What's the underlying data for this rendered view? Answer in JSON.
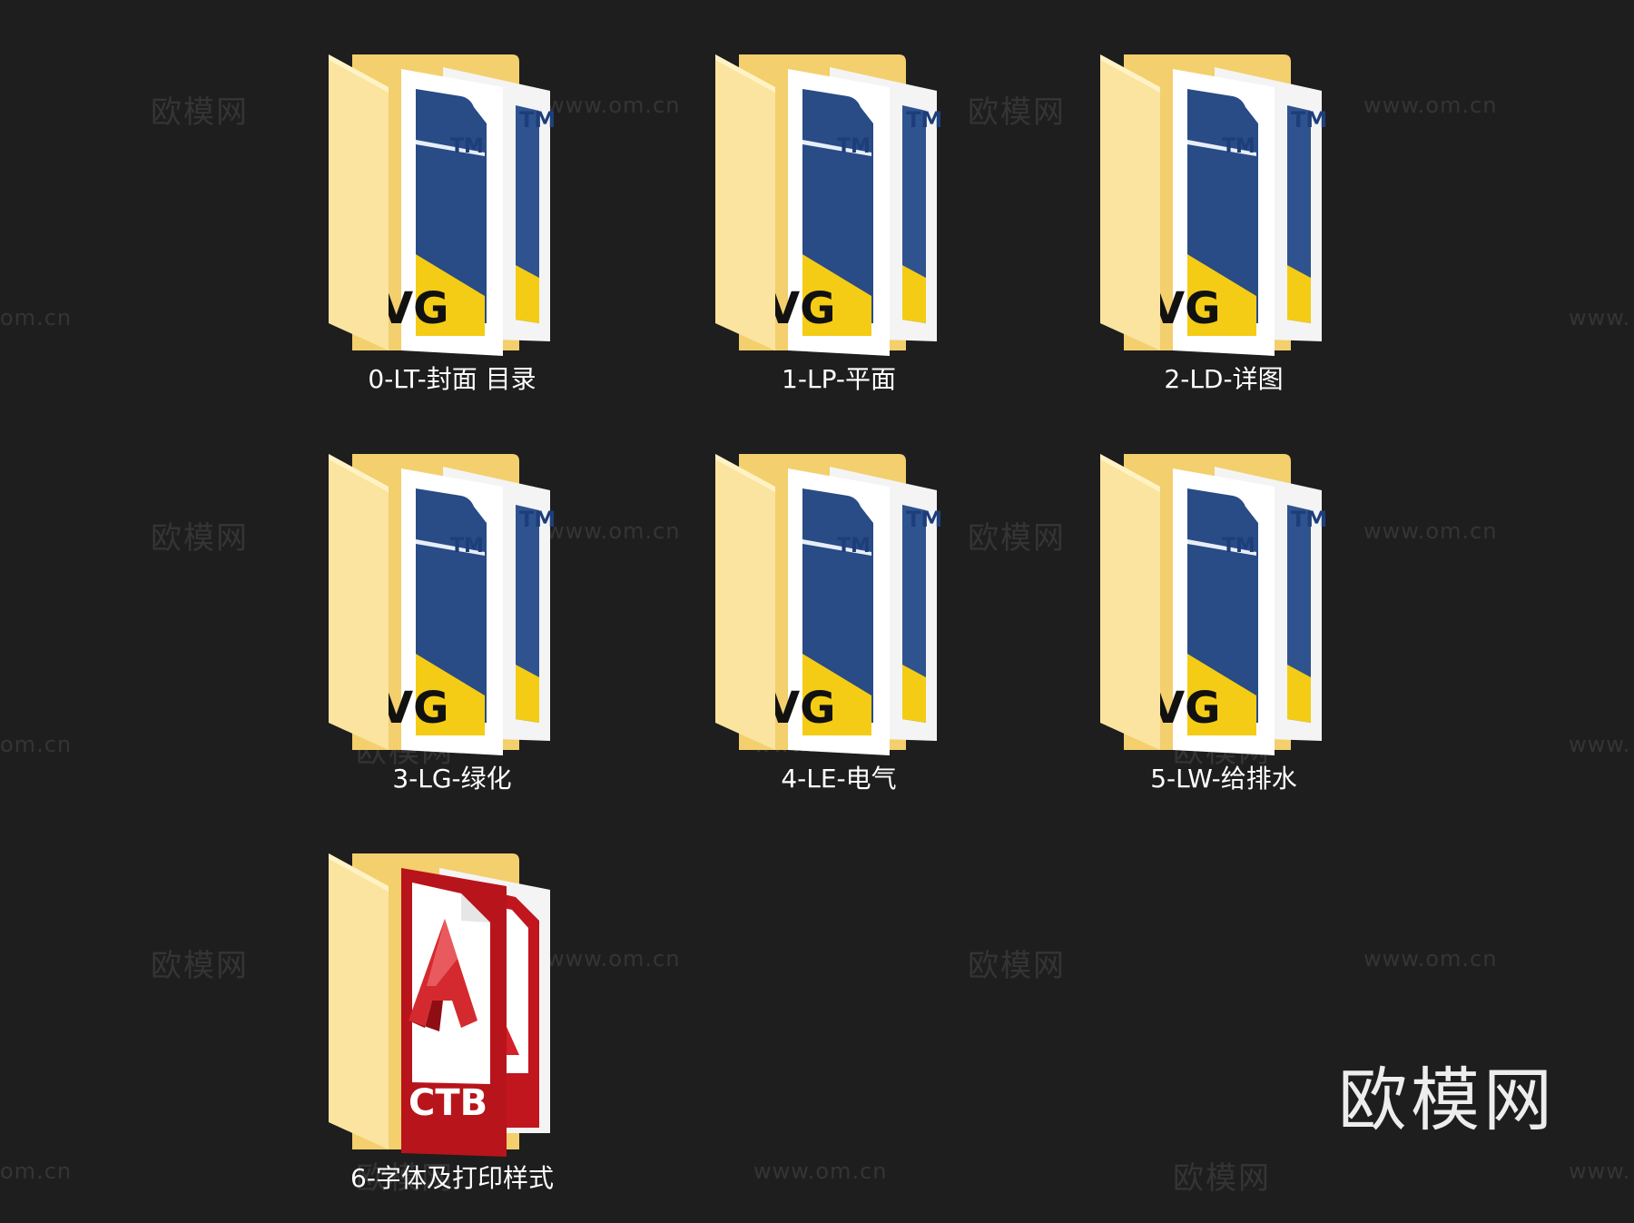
{
  "folders": [
    {
      "name": "0-LT-封面 目录",
      "type": "dwg"
    },
    {
      "name": "1-LP-平面",
      "type": "dwg"
    },
    {
      "name": "2-LD-详图",
      "type": "dwg"
    },
    {
      "name": "3-LG-绿化",
      "type": "dwg"
    },
    {
      "name": "4-LE-电气",
      "type": "dwg"
    },
    {
      "name": "5-LW-给排水",
      "type": "dwg"
    },
    {
      "name": "6-字体及打印样式",
      "type": "ctb"
    }
  ],
  "file_badges": {
    "dwg_tm": "TM",
    "dwg_text": "VG",
    "ctb_text": "CTB"
  },
  "watermark": {
    "brand": "欧模网",
    "url": "www.om.cn",
    "url_fragment_left": "om.cn",
    "url_fragment_right": "www."
  },
  "colors": {
    "background": "#1e1e1e",
    "folder_front": "#fbe4a0",
    "folder_back": "#f3cf6d",
    "dwg_blue": "#27467e",
    "dwg_yellow": "#f4cc16",
    "ctb_red": "#c1161e"
  }
}
